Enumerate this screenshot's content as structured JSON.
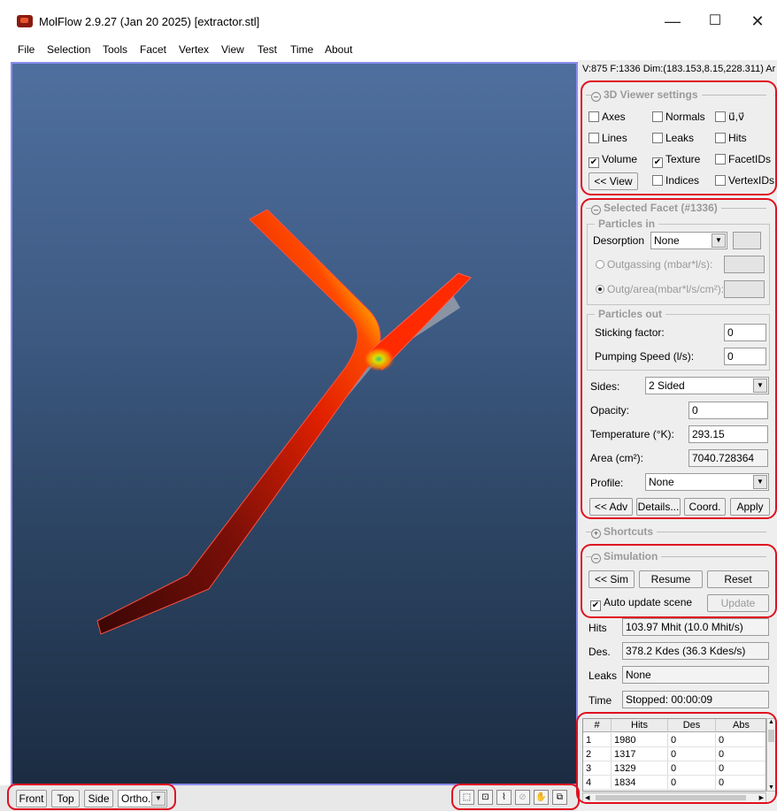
{
  "window": {
    "title": "MolFlow 2.9.27 (Jan 20 2025) [extractor.stl]",
    "minimize_glyph": "—",
    "maximize_glyph": "☐",
    "close_glyph": "✕"
  },
  "menu": [
    "File",
    "Selection",
    "Tools",
    "Facet",
    "Vertex",
    "View",
    "Test",
    "Time",
    "About"
  ],
  "status_line": "V:875 F:1336 Dim:(183.153,8.15,228.311) Ar",
  "viewer_settings": {
    "title": "3D Viewer settings",
    "checkboxes": [
      {
        "label": "Axes",
        "checked": false
      },
      {
        "label": "Normals",
        "checked": false
      },
      {
        "label": "u⃗,v⃗",
        "checked": false
      },
      {
        "label": "Lines",
        "checked": false
      },
      {
        "label": "Leaks",
        "checked": false
      },
      {
        "label": "Hits",
        "checked": false
      },
      {
        "label": "Volume",
        "checked": true
      },
      {
        "label": "Texture",
        "checked": true
      },
      {
        "label": "FacetIDs",
        "checked": false
      },
      {
        "label": "Indices",
        "checked": false
      },
      {
        "label": "VertexIDs",
        "checked": false
      }
    ],
    "view_button": "<< View"
  },
  "selected_facet": {
    "title": "Selected Facet (#1336)",
    "particles_in": {
      "title": "Particles in",
      "desorption_label": "Desorption",
      "desorption_value": "None",
      "outgassing_label": "Outgassing (mbar*l/s):",
      "outg_area_label": "Outg/area(mbar*l/s/cm²):"
    },
    "particles_out": {
      "title": "Particles out",
      "sticking_label": "Sticking factor:",
      "sticking_value": "0",
      "pumping_label": "Pumping Speed (l/s):",
      "pumping_value": "0"
    },
    "sides_label": "Sides:",
    "sides_value": "2 Sided",
    "opacity_label": "Opacity:",
    "opacity_value": "0",
    "temperature_label": "Temperature (°K):",
    "temperature_value": "293.15",
    "area_label": "Area (cm²):",
    "area_value": "7040.728364",
    "profile_label": "Profile:",
    "profile_value": "None",
    "buttons": {
      "adv": "<< Adv",
      "details": "Details...",
      "coord": "Coord.",
      "apply": "Apply"
    }
  },
  "shortcuts": {
    "title": "Shortcuts"
  },
  "simulation": {
    "title": "Simulation",
    "sim_button": "<< Sim",
    "resume_button": "Resume",
    "reset_button": "Reset",
    "auto_update_label": "Auto update scene",
    "update_button": "Update",
    "hits_label": "Hits",
    "hits_value": "103.97 Mhit (10.0 Mhit/s)",
    "des_label": "Des.",
    "des_value": "378.2 Kdes (36.3 Kdes/s)",
    "leaks_label": "Leaks",
    "leaks_value": "None",
    "time_label": "Time",
    "time_value": "Stopped: 00:00:09"
  },
  "facet_table": {
    "headers": [
      "#",
      "Hits",
      "Des",
      "Abs"
    ],
    "rows": [
      [
        "1",
        "1980",
        "0",
        "0"
      ],
      [
        "2",
        "1317",
        "0",
        "0"
      ],
      [
        "3",
        "1329",
        "0",
        "0"
      ],
      [
        "4",
        "1834",
        "0",
        "0"
      ]
    ]
  },
  "bottom_toolbar": {
    "front": "Front",
    "top": "Top",
    "side": "Side",
    "projection": "Ortho."
  },
  "colors": {
    "viewport_top": "#4f6f9e",
    "viewport_bottom": "#1b2c42",
    "annotation_red": "#e01020",
    "facet_hot": "#ff2a00",
    "facet_cold": "#3a0705"
  }
}
